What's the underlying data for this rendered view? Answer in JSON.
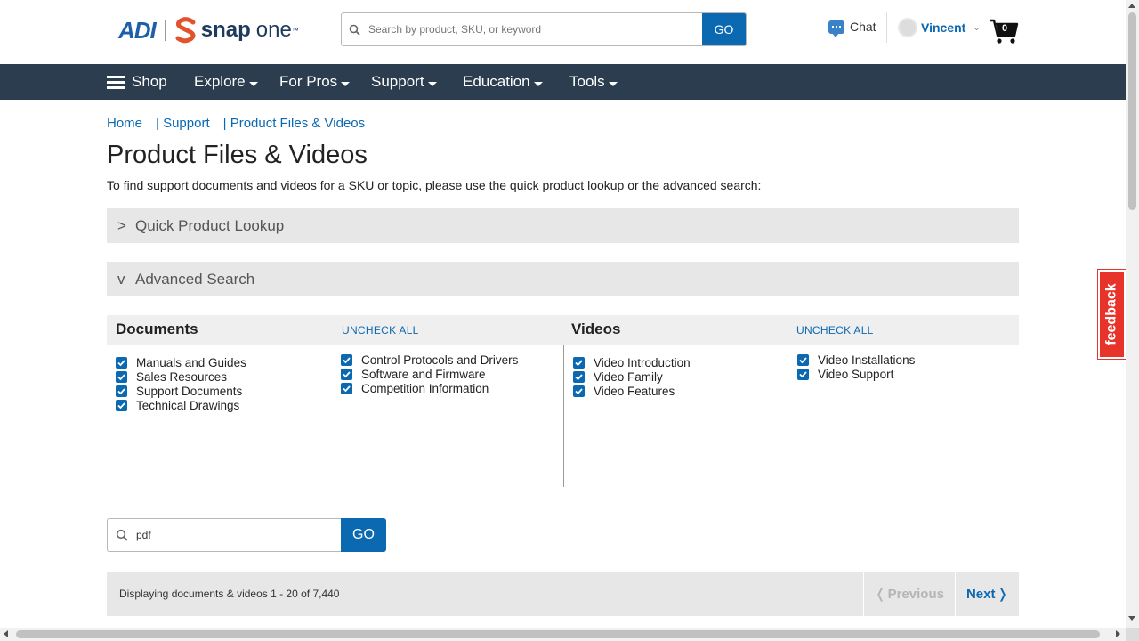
{
  "header": {
    "logo": {
      "primary": "ADI",
      "secondary": "snap",
      "tertiary": "one",
      "trademark": "™"
    },
    "search": {
      "placeholder": "Search by product, SKU, or keyword",
      "button_label": "GO"
    },
    "chat_label": "Chat",
    "user_name": "Vincent",
    "cart_count": "0"
  },
  "nav": {
    "items": [
      {
        "label": "Shop"
      },
      {
        "label": "Explore"
      },
      {
        "label": "For Pros"
      },
      {
        "label": "Support"
      },
      {
        "label": "Education"
      },
      {
        "label": "Tools"
      }
    ]
  },
  "breadcrumb": [
    "Home",
    "| Support",
    "| Product Files & Videos"
  ],
  "page": {
    "title": "Product Files & Videos",
    "intro": "To find support documents and videos for a SKU or topic, please use the quick product lookup or the advanced search:"
  },
  "accordions": [
    {
      "arrow": ">",
      "label": "Quick Product Lookup"
    },
    {
      "arrow": "v",
      "label": "Advanced Search"
    }
  ],
  "documents": {
    "title": "Documents",
    "uncheck_label": "UNCHECK ALL",
    "col1": [
      "Manuals and Guides",
      "Sales Resources",
      "Support Documents",
      "Technical Drawings"
    ],
    "col2": [
      "Control Protocols and Drivers",
      "Software and Firmware",
      "Competition Information"
    ]
  },
  "videos": {
    "title": "Videos",
    "uncheck_label": "UNCHECK ALL",
    "col1": [
      "Video Introduction",
      "Video Family",
      "Video Features"
    ],
    "col2": [
      "Video Installations",
      "Video Support"
    ]
  },
  "keyword_search": {
    "value": "pdf",
    "button_label": "GO"
  },
  "results": {
    "summary": "Displaying documents & videos 1 - 20 of 7,440",
    "prev_label": "Previous",
    "next_label": "Next"
  },
  "feedback_label": "feedback",
  "colors": {
    "brand_blue": "#0b69b2",
    "nav_bg": "#2b3d4f",
    "feedback_red": "#e8332a"
  }
}
